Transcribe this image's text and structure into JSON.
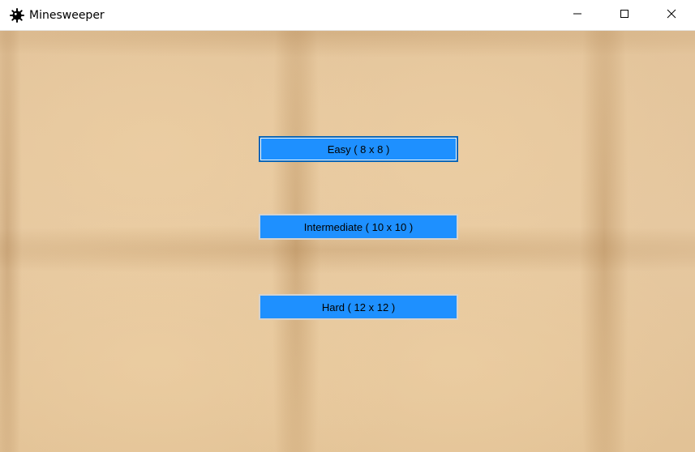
{
  "window": {
    "title": "Minesweeper",
    "icon": "mine-icon",
    "controls": [
      "minimize-icon",
      "maximize-icon",
      "close-icon"
    ]
  },
  "menu": {
    "easy_label": "Easy ( 8 x 8 )",
    "intermediate_label": "Intermediate ( 10 x 10 )",
    "hard_label": "Hard ( 12 x 12 )"
  },
  "colors": {
    "button_bg": "#1e90ff",
    "background": "#e3c49b"
  }
}
